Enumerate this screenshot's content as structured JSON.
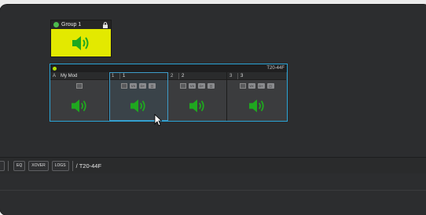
{
  "group": {
    "name": "Group 1"
  },
  "device": {
    "model": "T20-44F",
    "channels": [
      {
        "index": "A",
        "label": "My Mod",
        "has_controls": false
      },
      {
        "index": "1",
        "label": "1",
        "has_controls": true,
        "selected": true
      },
      {
        "index": "2",
        "label": "2",
        "has_controls": true
      },
      {
        "index": "3",
        "label": "3",
        "has_controls": true
      }
    ],
    "ctrl_labels": {
      "vx": "VX",
      "d": "D+",
      "m": "◫"
    }
  },
  "toolbar": {
    "eq_label": "EQ",
    "xover_label": "XOVER",
    "logs_label": "LOGS",
    "path": "/ T20-44F"
  },
  "colors": {
    "group_fill": "#e3e900",
    "speaker_green": "#1fa81f",
    "device_border": "#2aa4d6"
  }
}
